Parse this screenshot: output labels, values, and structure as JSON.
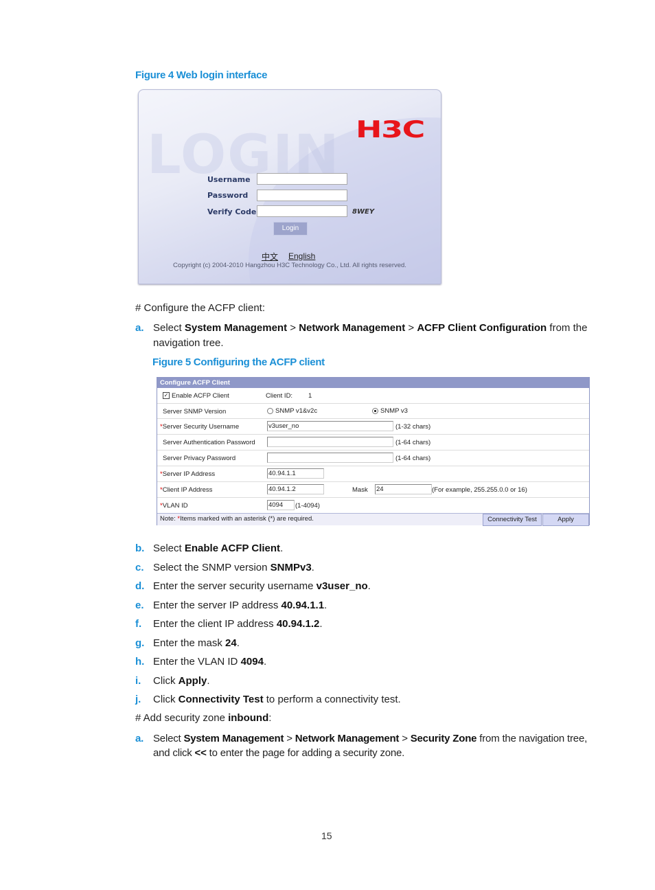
{
  "figure4": {
    "title": "Figure 4 Web login interface",
    "login": {
      "background_word": "LOGIN",
      "logo": "H3C",
      "logo_color": "#e8151b",
      "username_label": "Username",
      "username_value": "",
      "password_label": "Password",
      "password_value": "",
      "verify_label": "Verify Code",
      "verify_value": "",
      "verify_code_text": "8WEY",
      "login_button": "Login",
      "lang_chinese": "中文",
      "lang_english": "English",
      "copyright": "Copyright (c) 2004-2010 Hangzhou H3C Technology Co., Ltd. All rights reserved."
    }
  },
  "intro_configure": "# Configure the ACFP client:",
  "step_a": {
    "marker": "a.",
    "pre": "Select ",
    "p1": "System Management",
    "sep1": " > ",
    "p2": "Network Management",
    "sep2": " > ",
    "p3": "ACFP Client Configuration",
    "post": " from the",
    "line2": "navigation tree."
  },
  "figure5": {
    "title": "Figure 5 Configuring the ACFP client",
    "panel_title": "Configure ACFP Client",
    "enable_label": "Enable ACFP Client",
    "enable_checked": true,
    "client_id_label": "Client ID:",
    "client_id_value": "1",
    "snmp_version_label": "Server SNMP Version",
    "snmp_options": [
      {
        "label": "SNMP v1&v2c",
        "selected": false
      },
      {
        "label": "SNMP v3",
        "selected": true
      }
    ],
    "required_mark": "*",
    "security_username_label": "Server Security Username",
    "security_username_value": "v3user_no",
    "security_username_hint": "(1-32 chars)",
    "auth_password_label": "Server Authentication Password",
    "auth_password_value": "",
    "auth_password_hint": "(1-64 chars)",
    "privacy_password_label": "Server Privacy Password",
    "privacy_password_value": "",
    "privacy_password_hint": "(1-64 chars)",
    "server_ip_label": "Server IP Address",
    "server_ip_value": "40.94.1.1",
    "client_ip_label": "Client IP Address",
    "client_ip_value": "40.94.1.2",
    "mask_label": "Mask",
    "mask_value": "24",
    "mask_hint": "(For example, 255.255.0.0 or 16)",
    "vlan_label": "VLAN ID",
    "vlan_value": "4094",
    "vlan_hint": "(1-4094)",
    "note_prefix": "Note: ",
    "note_text": "Items marked with an asterisk (*) are required.",
    "connectivity_button": "Connectivity Test",
    "apply_button": "Apply"
  },
  "steps": [
    {
      "marker": "b.",
      "pre": "Select ",
      "bold": "Enable ACFP Client",
      "post": "."
    },
    {
      "marker": "c.",
      "pre": "Select the SNMP version ",
      "bold": "SNMPv3",
      "post": "."
    },
    {
      "marker": "d.",
      "pre": "Enter the server security username ",
      "bold": "v3user_no",
      "post": "."
    },
    {
      "marker": "e.",
      "pre": "Enter the server IP address ",
      "bold": "40.94.1.1",
      "post": "."
    },
    {
      "marker": "f.",
      "pre": "Enter the client IP address ",
      "bold": "40.94.1.2",
      "post": "."
    },
    {
      "marker": "g.",
      "pre": "Enter the mask ",
      "bold": "24",
      "post": "."
    },
    {
      "marker": "h.",
      "pre": "Enter the VLAN ID ",
      "bold": "4094",
      "post": "."
    },
    {
      "marker": "i.",
      "pre": "Click ",
      "bold": "Apply",
      "post": "."
    },
    {
      "marker": "j.",
      "pre": "Click ",
      "bold": "Connectivity Test",
      "post": " to perform a connectivity test."
    }
  ],
  "intro_zone": {
    "pre": "# Add security zone ",
    "bold": "inbound",
    "post": ":"
  },
  "zone_step_a": {
    "marker": "a.",
    "pre": "Select ",
    "p1": "System Management",
    "sep1": " > ",
    "p2": "Network Management",
    "sep2": " > ",
    "p3": "Security Zone",
    "post": " from the navigation tree,",
    "line2_pre": "and click ",
    "line2_bold": "<<",
    "line2_post": " to enter the page for adding a security zone."
  },
  "page_number": "15",
  "colors": {
    "accent": "#1a8fd6",
    "panel_header": "#8f98c8"
  }
}
